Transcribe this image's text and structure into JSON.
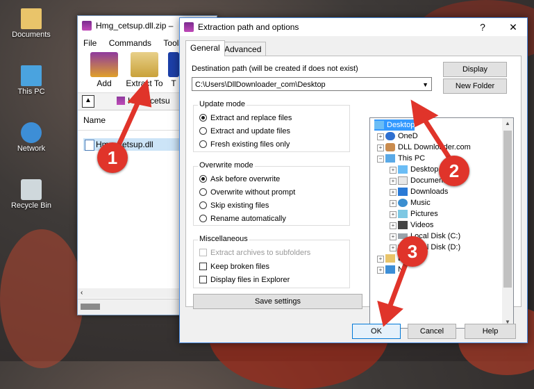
{
  "desktop": {
    "icons": [
      {
        "label": "Documents",
        "icon": "folder-documents-icon"
      },
      {
        "label": "This PC",
        "icon": "computer-icon"
      },
      {
        "label": "Network",
        "icon": "network-icon"
      },
      {
        "label": "Recycle Bin",
        "icon": "recycle-bin-icon"
      }
    ]
  },
  "winrar": {
    "title": "Hmg_cetsup.dll.zip",
    "menu": [
      "File",
      "Commands",
      "Tools"
    ],
    "toolbar": {
      "add": "Add",
      "extract": "Extract To",
      "extra": "T"
    },
    "address": "Hmg_cetsu",
    "list_header": "Name",
    "file": "Hmg_cetsup.dll"
  },
  "dialog": {
    "title": "Extraction path and options",
    "help": "?",
    "close": "✕",
    "tabs": [
      "General",
      "Advanced"
    ],
    "dest_label": "Destination path (will be created if does not exist)",
    "dest_value": "C:\\Users\\DllDownloader_com\\Desktop",
    "display_button": "Display",
    "new_folder_button": "New Folder",
    "update_mode": {
      "title": "Update mode",
      "options": [
        "Extract and replace files",
        "Extract and update files",
        "Fresh existing files only"
      ],
      "selected": 0
    },
    "overwrite_mode": {
      "title": "Overwrite mode",
      "options": [
        "Ask before overwrite",
        "Overwrite without prompt",
        "Skip existing files",
        "Rename automatically"
      ],
      "selected": 0
    },
    "misc": {
      "title": "Miscellaneous",
      "options": [
        "Extract archives to subfolders",
        "Keep broken files",
        "Display files in Explorer"
      ]
    },
    "save_settings": "Save settings",
    "tree": [
      "Desktop",
      "OneD",
      "DLL Downloader.com",
      "This PC",
      "Desktop",
      "Documents",
      "Downloads",
      "Music",
      "Pictures",
      "Videos",
      "Local Disk (C:)",
      "Local Disk (D:)",
      "Lib",
      "N"
    ],
    "ok": "OK",
    "cancel": "Cancel",
    "help_button": "Help"
  },
  "annotations": [
    "1",
    "2",
    "3"
  ],
  "colors": {
    "selection": "#3399ff",
    "badge": "#e0342a",
    "ok_border": "#0078d7"
  }
}
